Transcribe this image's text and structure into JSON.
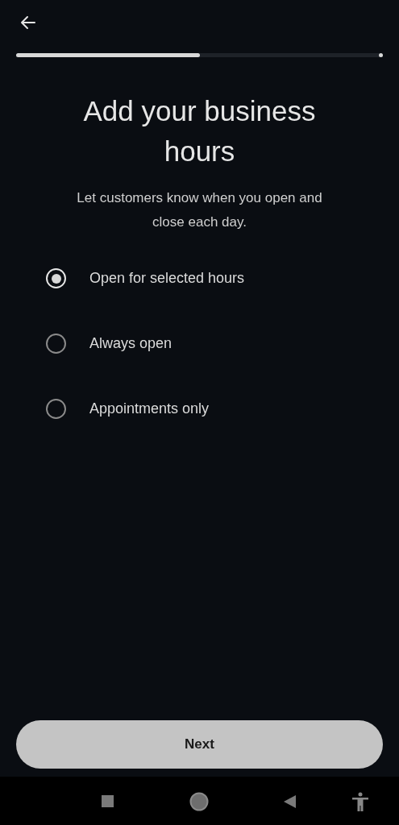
{
  "progress": {
    "level": 0.5
  },
  "title": "Add your business hours",
  "subtitle": "Let customers know when you open and close each day.",
  "options": [
    {
      "label": "Open for selected hours",
      "selected": true
    },
    {
      "label": "Always open",
      "selected": false
    },
    {
      "label": "Appointments only",
      "selected": false
    }
  ],
  "next_button": "Next"
}
